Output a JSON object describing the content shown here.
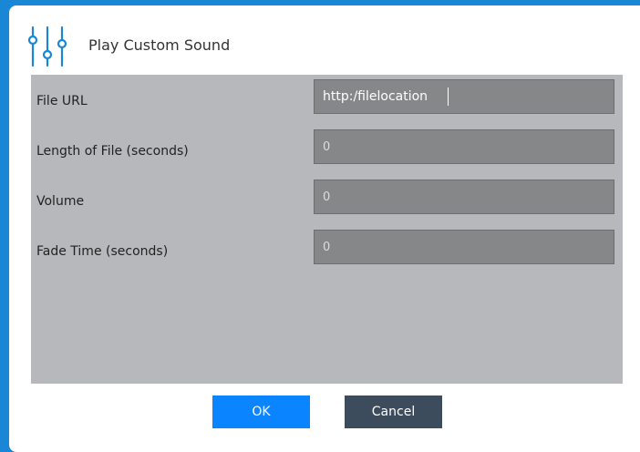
{
  "dialog": {
    "title": "Play Custom Sound",
    "icon": "sliders-icon",
    "accent_color": "#1a86d6"
  },
  "fields": [
    {
      "label": "File URL",
      "value": "http:/filelocation"
    },
    {
      "label": "Length of File (seconds)",
      "value": "0"
    },
    {
      "label": "Volume",
      "value": "0"
    },
    {
      "label": "Fade Time (seconds)",
      "value": "0"
    }
  ],
  "buttons": {
    "ok_label": "OK",
    "cancel_label": "Cancel",
    "ok_color": "#0a84ff",
    "cancel_color": "#3d4c5c"
  }
}
